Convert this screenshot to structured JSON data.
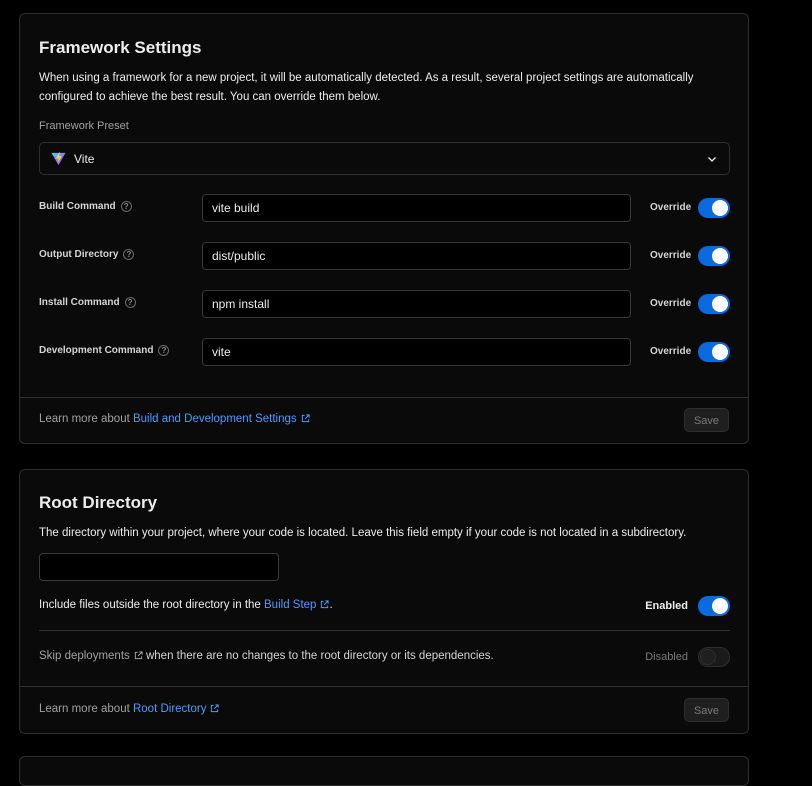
{
  "framework": {
    "title": "Framework Settings",
    "description_line1": "When using a framework for a new project, it will be automatically detected. As a result, several project settings are automatically",
    "description_line2": "configured to achieve the best result. You can override them below.",
    "preset_label": "Framework Preset",
    "preset_value": "Vite",
    "override_label": "Override",
    "help_glyph": "?",
    "rows": [
      {
        "label": "Build Command",
        "value": "vite build",
        "override": true
      },
      {
        "label": "Output Directory",
        "value": "dist/public",
        "override": true
      },
      {
        "label": "Install Command",
        "value": "npm install",
        "override": true
      },
      {
        "label": "Development Command",
        "value": "vite",
        "override": true
      }
    ],
    "footer": {
      "learn_prefix": "Learn more about ",
      "learn_link": "Build and Development Settings",
      "save_label": "Save"
    }
  },
  "root": {
    "title": "Root Directory",
    "description": "The directory within your project, where your code is located. Leave this field empty if your code is not located in a subdirectory.",
    "input_value": "",
    "include_prefix": "Include files outside the root directory in the ",
    "include_link": "Build Step",
    "include_suffix": ".",
    "include_state": "Enabled",
    "skip_link": "Skip deployments",
    "skip_suffix": " when there are no changes to the root directory or its dependencies.",
    "skip_state": "Disabled",
    "footer": {
      "learn_prefix": "Learn more about ",
      "learn_link": "Root Directory",
      "save_label": "Save"
    }
  },
  "colors": {
    "accent": "#0a6ae0",
    "link": "#4d9bff",
    "background": "#000000",
    "card": "#0a0a0a",
    "border": "#2e2e2e"
  },
  "icons": [
    "vite-logo-icon",
    "chevron-down-icon",
    "help-icon",
    "external-link-icon"
  ]
}
